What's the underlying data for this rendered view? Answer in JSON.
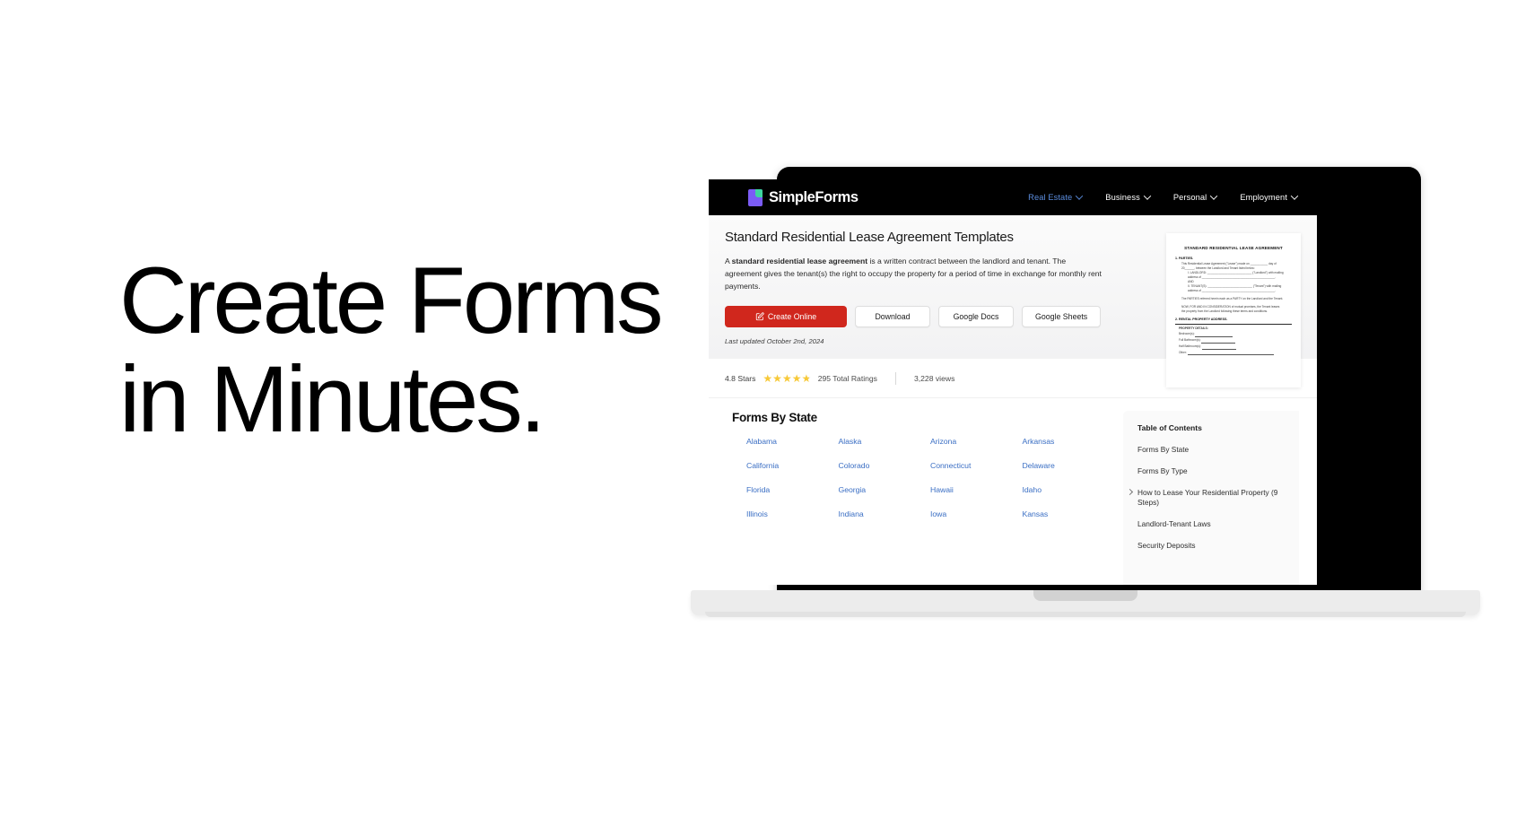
{
  "hero": {
    "line1": "Create Forms",
    "line2": "in Minutes."
  },
  "site": {
    "brand": "SimpleForms",
    "brand_icon": "document-icon",
    "nav": [
      {
        "label": "Real Estate",
        "active": true,
        "icon": "chevron-down-icon"
      },
      {
        "label": "Business",
        "active": false,
        "icon": "chevron-down-icon"
      },
      {
        "label": "Personal",
        "active": false,
        "icon": "chevron-down-icon"
      },
      {
        "label": "Employment",
        "active": false,
        "icon": "chevron-down-icon"
      }
    ]
  },
  "article": {
    "title": "Standard Residential Lease Agreement Templates",
    "desc_lead": "A ",
    "desc_bold": "standard residential lease agreement",
    "desc_rest": " is a written contract between the landlord and tenant. The agreement gives the tenant(s) the right to occupy the property for a period of time in exchange for monthly rent payments.",
    "buttons": {
      "create": "Create Online",
      "create_icon": "pen-square-icon",
      "download": "Download",
      "google_docs": "Google Docs",
      "google_sheets": "Google Sheets"
    },
    "last_updated": "Last updated October 2nd, 2024"
  },
  "ratings": {
    "score_label": "4.8 Stars",
    "star_icon": "star-icon",
    "stars_full": 4,
    "stars_partial": 1,
    "total_label": "295 Total Ratings",
    "views_label": "3,228 views",
    "star_color": "#f7c938"
  },
  "preview": {
    "title": "STANDARD RESIDENTIAL LEASE AGREEMENT",
    "sec1": "1. PARTIES.",
    "sec1_l1": "This Residential Lease Agreement (\"Lease\") made on ___________ day of",
    "sec1_l2": "20______, between the Landlord and Tenant listed below:",
    "sec1_a": "I.  LANDLORD: ____________________________ (\"Landlord\") with mailing",
    "sec1_a2": "address of ______________________________________________.",
    "sec1_and": "AND",
    "sec1_b": "II. TENANT(S): ____________________________ (\"Tenant\") with mailing",
    "sec1_b2": "address of ______________________________________________.",
    "sec1_p1": "The PARTIES referred herein each as a PARTY on the Landlord and the Tenant.",
    "sec1_p2": "NOW, FOR AND IN CONSIDERATION of mutual promises, the Tenant leases",
    "sec1_p3": "the property from the Landlord following these terms and conditions.",
    "sec2": "2. RENTAL PROPERTY ADDRESS.",
    "details_title": "PROPERTY DETAILS:",
    "detail_1": "Bedroom(s):",
    "detail_2": "Full Bathroom(s):",
    "detail_3": "Half Bathroom(s):",
    "detail_4": "Other:"
  },
  "states_section": {
    "title": "Forms By State",
    "states": [
      "Alabama",
      "Alaska",
      "Arizona",
      "Arkansas",
      "California",
      "Colorado",
      "Connecticut",
      "Delaware",
      "Florida",
      "Georgia",
      "Hawaii",
      "Idaho",
      "Illinois",
      "Indiana",
      "Iowa",
      "Kansas"
    ],
    "link_color": "#3b6fc4"
  },
  "toc": {
    "title": "Table of Contents",
    "items": [
      {
        "label": "Forms By State",
        "expandable": false
      },
      {
        "label": "Forms By Type",
        "expandable": false
      },
      {
        "label": "How to Lease Your Residential Property (9 Steps)",
        "expandable": true,
        "icon": "chevron-right-icon"
      },
      {
        "label": "Landlord-Tenant Laws",
        "expandable": false
      },
      {
        "label": "Security Deposits",
        "expandable": false
      }
    ]
  }
}
